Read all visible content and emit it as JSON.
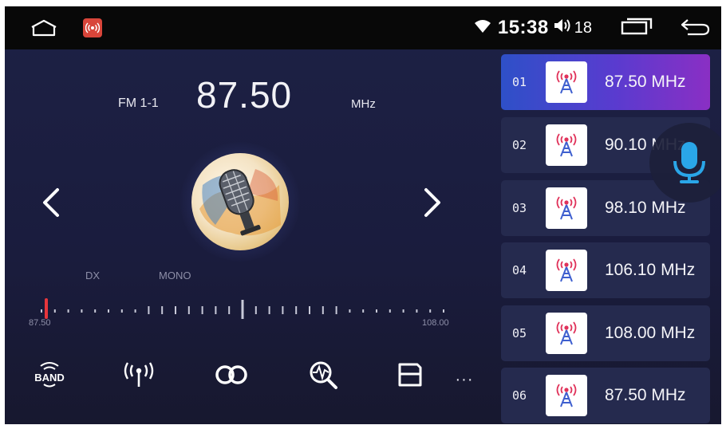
{
  "status_bar": {
    "time": "15:38",
    "volume_level": "18",
    "icons": [
      "home-icon",
      "radio-app-icon",
      "wifi-icon",
      "volume-icon",
      "recent-apps-icon",
      "back-icon"
    ]
  },
  "tuner": {
    "band": "FM 1-1",
    "frequency": "87.50",
    "unit": "MHz",
    "flags": {
      "dx": "DX",
      "mono": "MONO"
    },
    "scale": {
      "min_label": "87.50",
      "max_label": "108.00",
      "current_mhz": 87.5,
      "min_mhz": 87.5,
      "max_mhz": 108.0
    }
  },
  "toolbar": {
    "more": "···",
    "icons": [
      "band-icon",
      "antenna-icon",
      "stereo-icon",
      "scan-search-icon",
      "save-icon"
    ]
  },
  "presets": [
    {
      "num": "01",
      "freq": "87.50 MHz",
      "active": true
    },
    {
      "num": "02",
      "freq": "90.10 MHz",
      "active": false
    },
    {
      "num": "03",
      "freq": "98.10 MHz",
      "active": false
    },
    {
      "num": "04",
      "freq": "106.10 MHz",
      "active": false
    },
    {
      "num": "05",
      "freq": "108.00 MHz",
      "active": false
    },
    {
      "num": "06",
      "freq": "87.50 MHz",
      "active": false
    }
  ],
  "colors": {
    "background": "#1b1e40",
    "preset_bg": "#252a4e",
    "active_gradient_start": "#2e50c8",
    "active_gradient_end": "#8a2fc4",
    "scale_marker": "#e8363c",
    "mic": "#2aa6e8"
  }
}
